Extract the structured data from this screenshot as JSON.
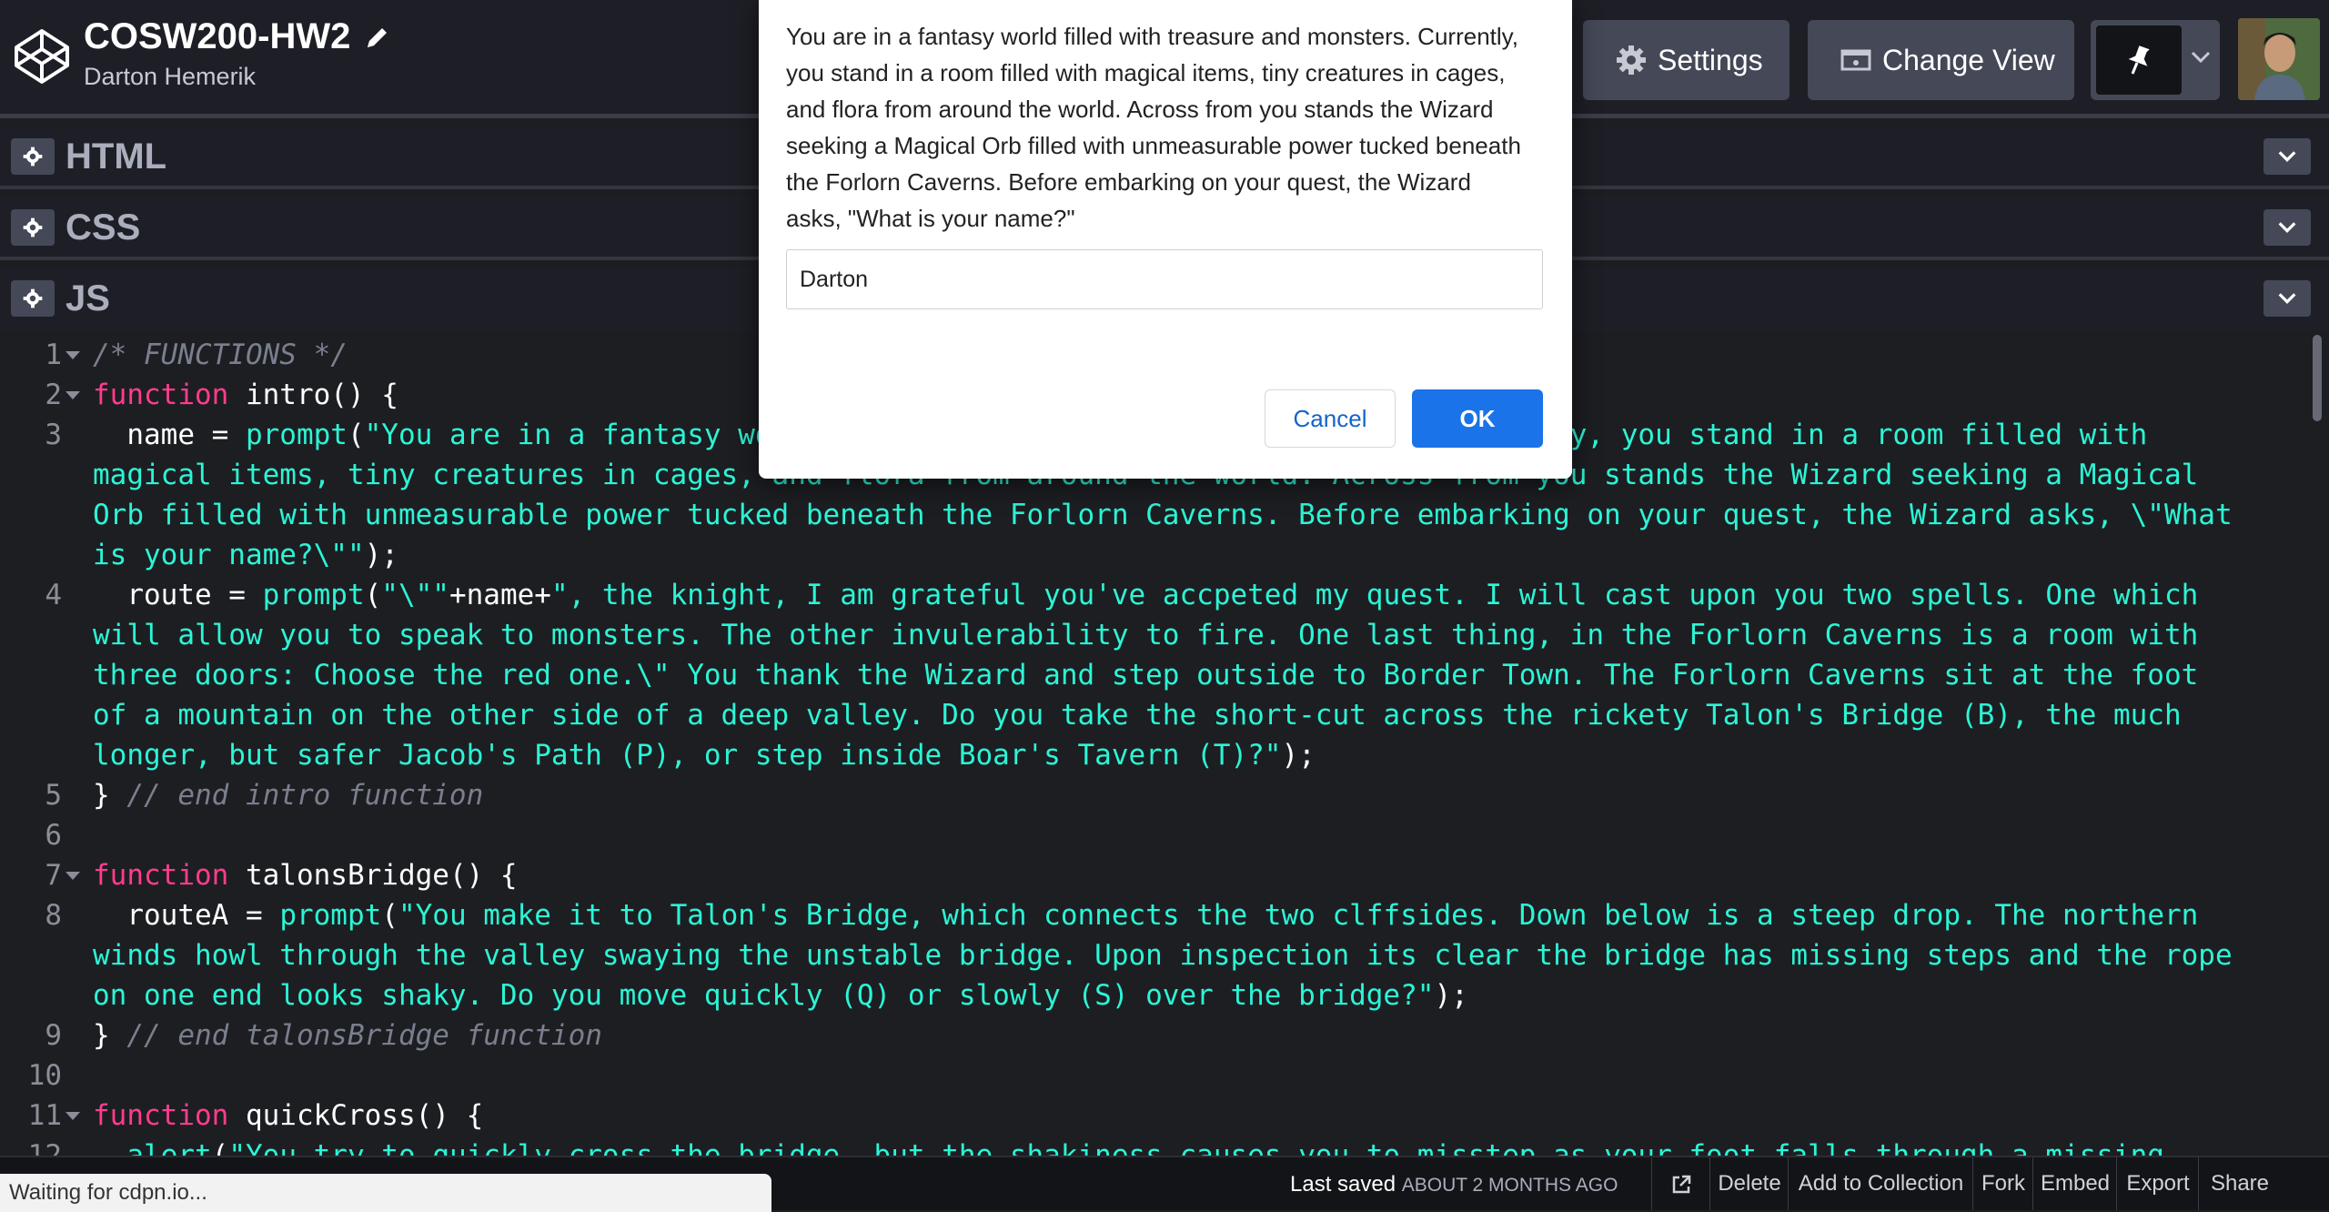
{
  "header": {
    "pen_title": "COSW200-HW2",
    "author": "Darton Hemerik",
    "settings_label": "Settings",
    "change_view_label": "Change View"
  },
  "editors": {
    "html_label": "HTML",
    "css_label": "CSS",
    "js_label": "JS"
  },
  "code": {
    "lines": [
      {
        "n": "1",
        "fold": true,
        "parts": [
          {
            "t": "cm",
            "v": "/* FUNCTIONS */"
          }
        ]
      },
      {
        "n": "2",
        "fold": true,
        "parts": [
          {
            "t": "kw",
            "v": "function"
          },
          {
            "t": "p",
            "v": " intro() {"
          }
        ]
      },
      {
        "n": "3",
        "fold": false,
        "parts": [
          {
            "t": "p",
            "v": "  name = "
          },
          {
            "t": "fn",
            "v": "prompt"
          },
          {
            "t": "p",
            "v": "("
          },
          {
            "t": "str",
            "v": "\"You are in a fantasy world filled with treasure and monsters. Currently, you stand in a room filled with magical items, tiny creatures in cages, and flora from around the world. Across from you stands the Wizard seeking a Magical Orb filled with unmeasurable power tucked beneath the Forlorn Caverns. Before embarking on your quest, the Wizard asks, \\\"What is your name?\\\"\""
          },
          {
            "t": "p",
            "v": ");"
          }
        ]
      },
      {
        "n": "4",
        "fold": false,
        "parts": [
          {
            "t": "p",
            "v": "  route = "
          },
          {
            "t": "fn",
            "v": "prompt"
          },
          {
            "t": "p",
            "v": "("
          },
          {
            "t": "str",
            "v": "\"\\\"\""
          },
          {
            "t": "p",
            "v": "+name+"
          },
          {
            "t": "str",
            "v": "\", the knight, I am grateful you've accpeted my quest. I will cast upon you two spells. One which will allow you to speak to monsters. The other invulerability to fire. One last thing, in the Forlorn Caverns is a room with three doors: Choose the red one.\\\" You thank the Wizard and step outside to Border Town. The Forlorn Caverns sit at the foot of a mountain on the other side of a deep valley. Do you take the short-cut across the rickety Talon's Bridge (B), the much longer, but safer Jacob's Path (P), or step inside Boar's Tavern (T)?\""
          },
          {
            "t": "p",
            "v": ");"
          }
        ]
      },
      {
        "n": "5",
        "fold": false,
        "parts": [
          {
            "t": "p",
            "v": "} "
          },
          {
            "t": "cm",
            "v": "// end intro function"
          }
        ]
      },
      {
        "n": "6",
        "fold": false,
        "parts": []
      },
      {
        "n": "7",
        "fold": true,
        "parts": [
          {
            "t": "kw",
            "v": "function"
          },
          {
            "t": "p",
            "v": " talonsBridge() {"
          }
        ]
      },
      {
        "n": "8",
        "fold": false,
        "parts": [
          {
            "t": "p",
            "v": "  routeA = "
          },
          {
            "t": "fn",
            "v": "prompt"
          },
          {
            "t": "p",
            "v": "("
          },
          {
            "t": "str",
            "v": "\"You make it to Talon's Bridge, which connects the two clffsides. Down below is a steep drop. The northern winds howl through the valley swaying the unstable bridge. Upon inspection its clear the bridge has missing steps and the rope on one end looks shaky. Do you move quickly (Q) or slowly (S) over the bridge?\""
          },
          {
            "t": "p",
            "v": ");"
          }
        ]
      },
      {
        "n": "9",
        "fold": false,
        "parts": [
          {
            "t": "p",
            "v": "} "
          },
          {
            "t": "cm",
            "v": "// end talonsBridge function"
          }
        ]
      },
      {
        "n": "10",
        "fold": false,
        "parts": []
      },
      {
        "n": "11",
        "fold": true,
        "parts": [
          {
            "t": "kw",
            "v": "function"
          },
          {
            "t": "p",
            "v": " quickCross() {"
          }
        ]
      },
      {
        "n": "12",
        "fold": false,
        "parts": [
          {
            "t": "p",
            "v": "  "
          },
          {
            "t": "fn",
            "v": "alert"
          },
          {
            "t": "p",
            "v": "("
          },
          {
            "t": "str",
            "v": "\"You try to quickly cross the bridge, but the shakiness causes you to misstep as your foot falls through a missing spot"
          }
        ]
      }
    ]
  },
  "footer": {
    "status_text": "Waiting for cdpn.io...",
    "last_saved_label": "Last saved",
    "last_saved_ago": "ABOUT 2 MONTHS AGO",
    "delete_label": "Delete",
    "add_collection_label": "Add to Collection",
    "fork_label": "Fork",
    "embed_label": "Embed",
    "export_label": "Export",
    "share_label": "Share"
  },
  "dialog": {
    "message": "You are in a fantasy world filled with treasure and monsters. Currently, you stand in a room filled with magical items, tiny creatures in cages, and flora from around the world. Across from you stands the Wizard seeking a Magical Orb filled with unmeasurable power tucked beneath the Forlorn Caverns. Before embarking on your quest, the Wizard asks, \"What is your name?\"",
    "input_value": "Darton",
    "cancel_label": "Cancel",
    "ok_label": "OK"
  },
  "colors": {
    "keyword": "#ff3c8e",
    "string": "#2bf5d6",
    "comment": "#7a7f8e",
    "ok_button": "#1a73e8"
  },
  "icons": [
    "codepen-logo-icon",
    "pencil-icon",
    "gear-icon",
    "change-view-icon",
    "pin-icon",
    "chevron-down-icon",
    "external-link-icon"
  ]
}
